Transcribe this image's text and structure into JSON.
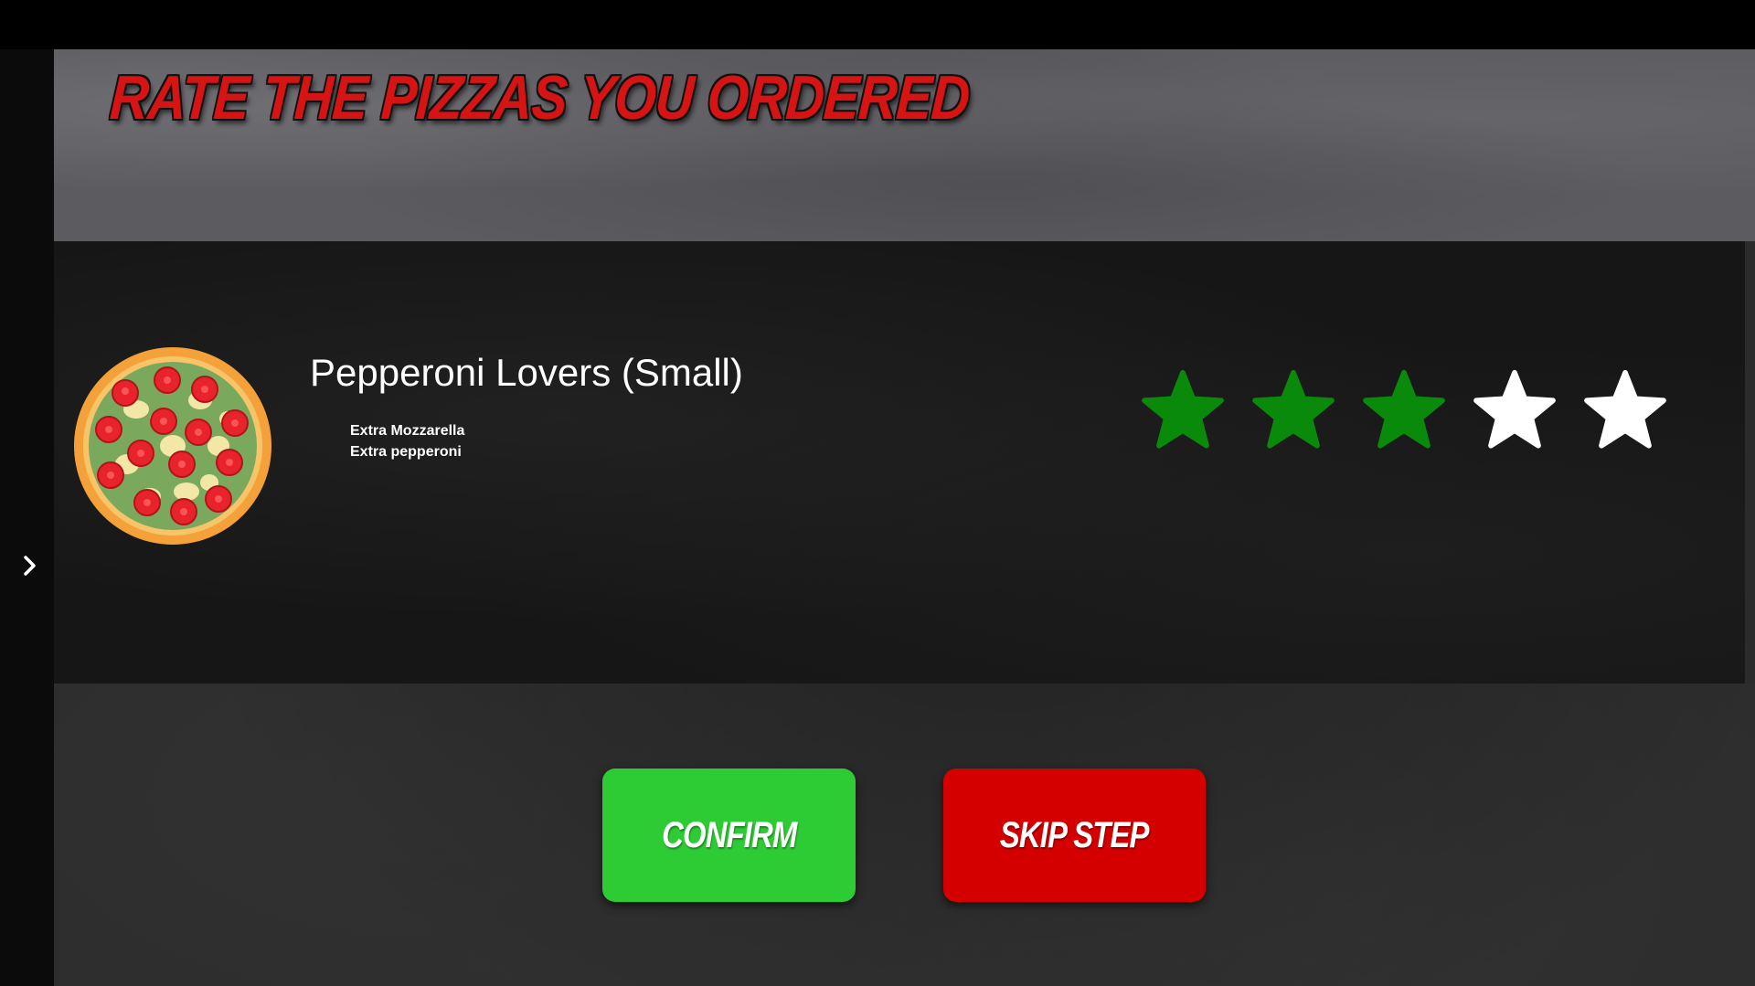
{
  "page": {
    "title": "RATE THE PIZZAS YOU ORDERED"
  },
  "colors": {
    "title_red": "#d61414",
    "star_filled": "#0a8a0a",
    "star_empty": "#ffffff",
    "confirm_green": "#2ecc34",
    "skip_red": "#d40000"
  },
  "sidebar": {
    "toggle_icon": "chevron-right-icon"
  },
  "item": {
    "image_icon": "pizza-icon",
    "name": "Pepperoni Lovers (Small)",
    "extras": [
      "Extra Mozzarella",
      "Extra pepperoni"
    ],
    "rating": {
      "value": 3,
      "max": 5
    }
  },
  "actions": {
    "confirm_label": "CONFIRM",
    "skip_label": "SKIP STEP"
  }
}
